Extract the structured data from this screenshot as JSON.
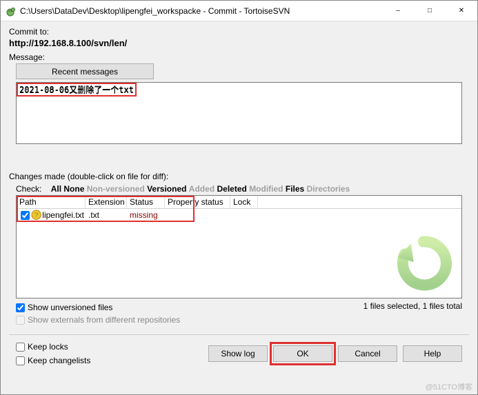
{
  "window": {
    "title": "C:\\Users\\DataDev\\Desktop\\lipengfei_workspacke - Commit - TortoiseSVN"
  },
  "commit_to_label": "Commit to:",
  "commit_url": "http://192.168.8.100/svn/len/",
  "message_label": "Message:",
  "recent_btn": "Recent messages",
  "message_text": "2021-08-06又删除了一个txt",
  "changes_label": "Changes made (double-click on file for diff):",
  "check": {
    "label": "Check:",
    "all": "All",
    "none": "None",
    "nonversioned": "Non-versioned",
    "versioned": "Versioned",
    "added": "Added",
    "deleted": "Deleted",
    "modified": "Modified",
    "files": "Files",
    "directories": "Directories"
  },
  "columns": {
    "path": "Path",
    "extension": "Extension",
    "status": "Status",
    "prop": "Property status",
    "lock": "Lock"
  },
  "files": [
    {
      "checked": true,
      "name": "lipengfei.txt",
      "ext": ".txt",
      "status": "missing"
    }
  ],
  "selection_status": "1 files selected, 1 files total",
  "show_unversioned": "Show unversioned files",
  "show_externals": "Show externals from different repositories",
  "keep_locks": "Keep locks",
  "keep_changelists": "Keep changelists",
  "buttons": {
    "showlog": "Show log",
    "ok": "OK",
    "cancel": "Cancel",
    "help": "Help"
  },
  "watermark": "@51CTO博客"
}
